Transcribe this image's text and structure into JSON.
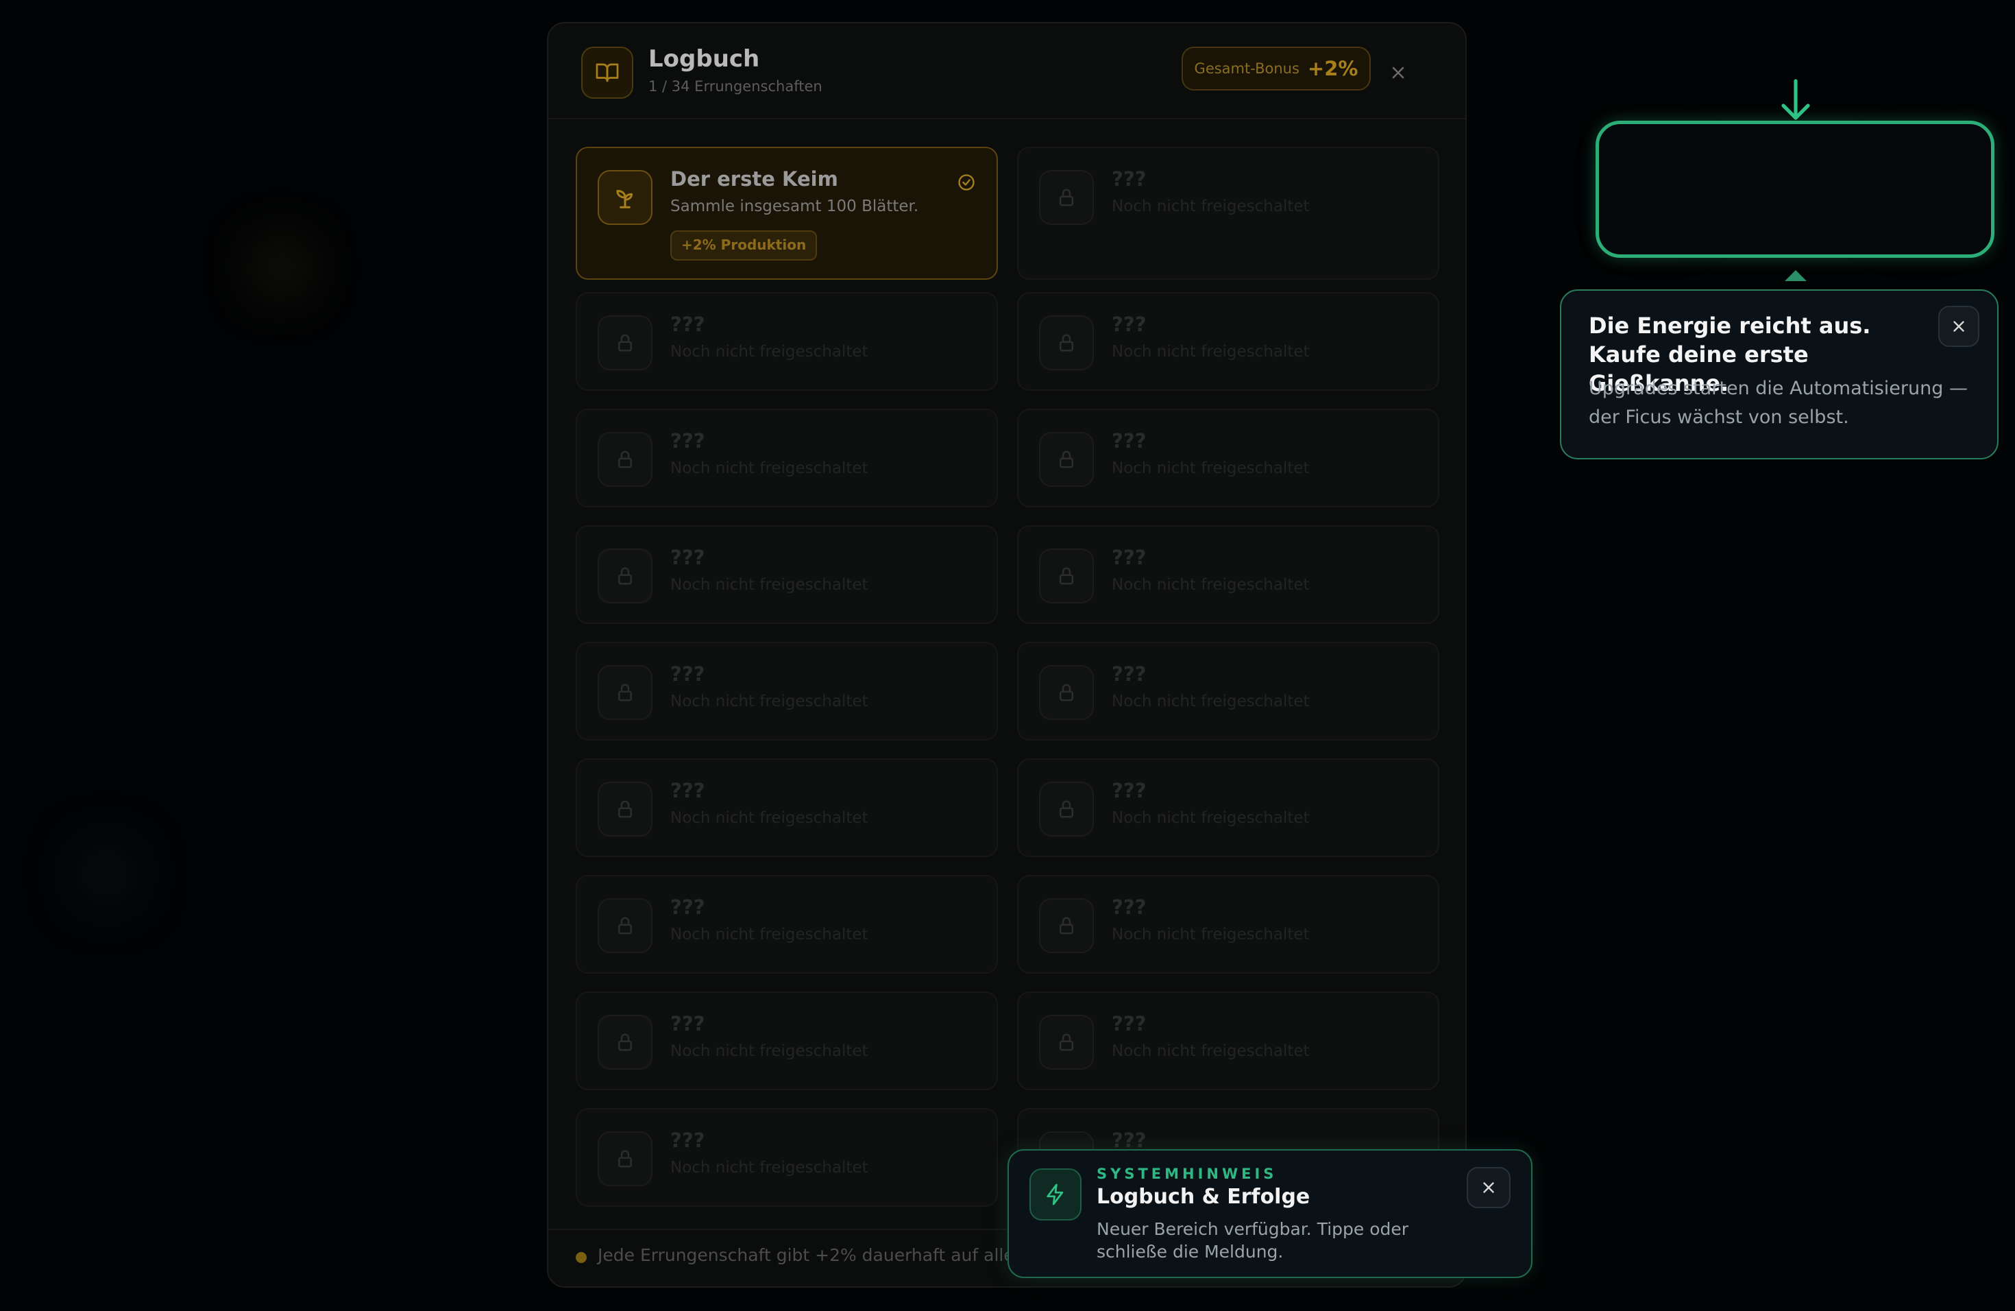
{
  "modal": {
    "title": "Logbuch",
    "subtitle": "1 / 34 Errungenschaften",
    "bonus_label": "Gesamt-Bonus",
    "bonus_value": "+2%",
    "icon": "book-icon",
    "close_icon": "close-icon"
  },
  "achievements": [
    {
      "title": "Der erste Keim",
      "desc": "Sammle insgesamt 100 Blätter.",
      "reward": "+2% Produktion",
      "unlocked": true,
      "icon": "sprout-icon"
    },
    {
      "title": "???",
      "desc": "Noch nicht freigeschaltet",
      "unlocked": false,
      "icon": "lock-icon"
    },
    {
      "title": "???",
      "desc": "Noch nicht freigeschaltet",
      "unlocked": false,
      "icon": "lock-icon"
    },
    {
      "title": "???",
      "desc": "Noch nicht freigeschaltet",
      "unlocked": false,
      "icon": "lock-icon"
    },
    {
      "title": "???",
      "desc": "Noch nicht freigeschaltet",
      "unlocked": false,
      "icon": "lock-icon"
    },
    {
      "title": "???",
      "desc": "Noch nicht freigeschaltet",
      "unlocked": false,
      "icon": "lock-icon"
    },
    {
      "title": "???",
      "desc": "Noch nicht freigeschaltet",
      "unlocked": false,
      "icon": "lock-icon"
    },
    {
      "title": "???",
      "desc": "Noch nicht freigeschaltet",
      "unlocked": false,
      "icon": "lock-icon"
    },
    {
      "title": "???",
      "desc": "Noch nicht freigeschaltet",
      "unlocked": false,
      "icon": "lock-icon"
    },
    {
      "title": "???",
      "desc": "Noch nicht freigeschaltet",
      "unlocked": false,
      "icon": "lock-icon"
    },
    {
      "title": "???",
      "desc": "Noch nicht freigeschaltet",
      "unlocked": false,
      "icon": "lock-icon"
    },
    {
      "title": "???",
      "desc": "Noch nicht freigeschaltet",
      "unlocked": false,
      "icon": "lock-icon"
    },
    {
      "title": "???",
      "desc": "Noch nicht freigeschaltet",
      "unlocked": false,
      "icon": "lock-icon"
    },
    {
      "title": "???",
      "desc": "Noch nicht freigeschaltet",
      "unlocked": false,
      "icon": "lock-icon"
    },
    {
      "title": "???",
      "desc": "Noch nicht freigeschaltet",
      "unlocked": false,
      "icon": "lock-icon"
    },
    {
      "title": "???",
      "desc": "Noch nicht freigeschaltet",
      "unlocked": false,
      "icon": "lock-icon"
    },
    {
      "title": "???",
      "desc": "Noch nicht freigeschaltet",
      "unlocked": false,
      "icon": "lock-icon"
    },
    {
      "title": "???",
      "desc": "Noch nicht freigeschaltet",
      "unlocked": false,
      "icon": "lock-icon"
    }
  ],
  "footer": {
    "text": "Jede Errungenschaft gibt +2% dauerhaft auf alle E"
  },
  "tutorial": {
    "title": "Die Energie reicht aus. Kaufe deine erste Gießkanne.",
    "body": "Upgrades starten die Automatisierung — der Ficus wächst von selbst.",
    "arrow_icon": "arrow-down-icon",
    "close_icon": "close-icon"
  },
  "toast": {
    "kicker": "SYSTEMHINWEIS",
    "title": "Logbuch & Erfolge",
    "body": "Neuer Bereich verfügbar. Tippe oder schließe die Meldung.",
    "icon": "lightning-icon",
    "close_icon": "close-icon"
  },
  "colors": {
    "accent_green": "#2cae79",
    "accent_gold": "#a7801c",
    "background": "#020304"
  }
}
